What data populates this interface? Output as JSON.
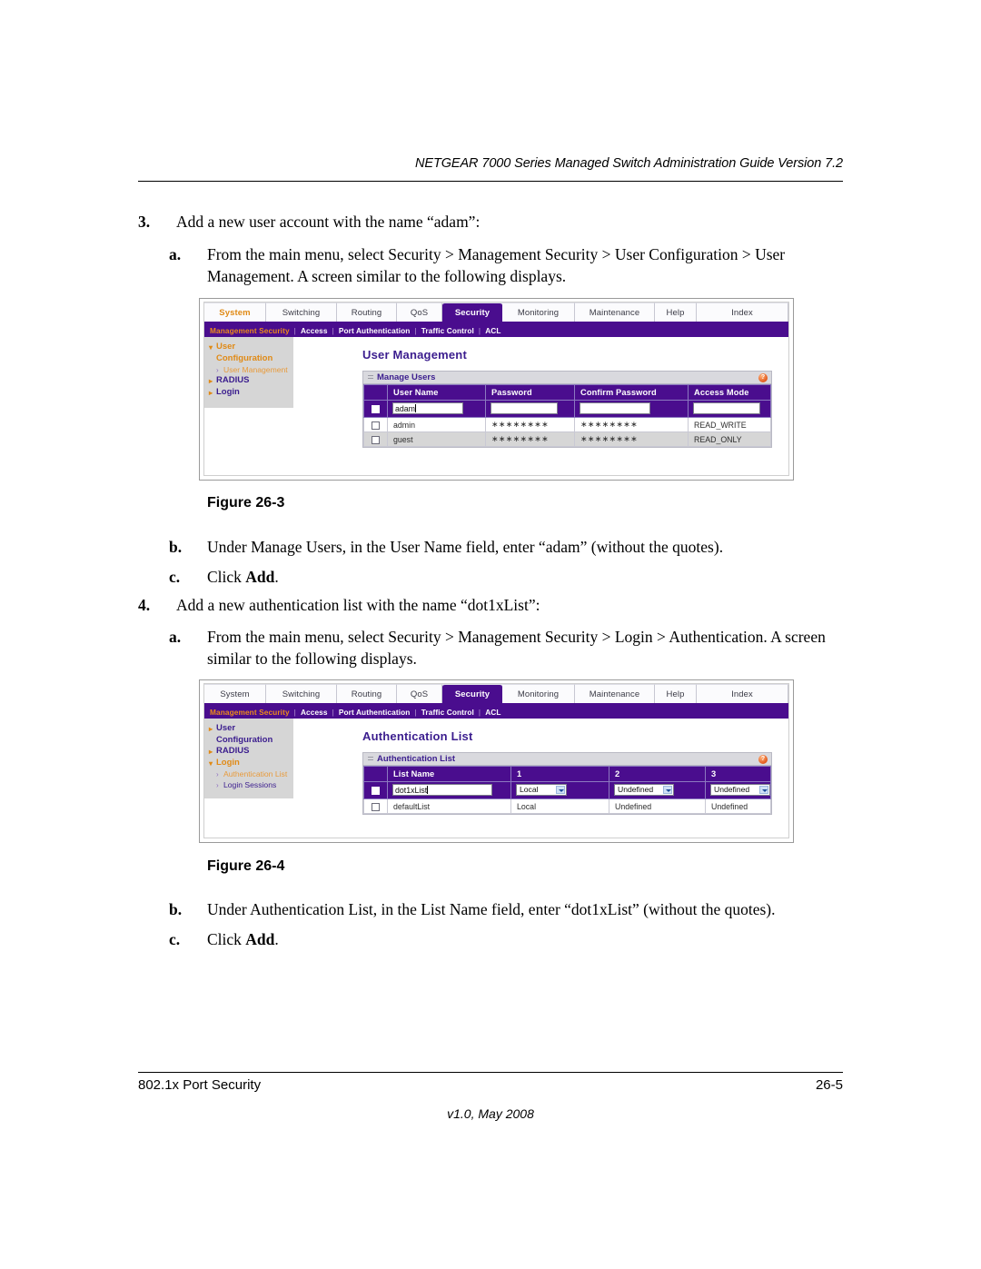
{
  "header": {
    "running_head": "NETGEAR 7000 Series Managed Switch Administration Guide Version 7.2"
  },
  "steps": [
    {
      "num": "3.",
      "text": "Add a new user account with the name “adam”:"
    },
    {
      "num": "a.",
      "text": "From the main menu, select Security > Management Security > User Configuration > User Management. A screen similar to the following displays."
    },
    {
      "num": "b.",
      "text": "Under Manage Users, in the User Name field, enter “adam” (without the quotes)."
    },
    {
      "num": "c.",
      "text_prefix": "Click ",
      "text_bold": "Add",
      "text_suffix": "."
    },
    {
      "num": "4.",
      "text": "Add a new authentication list with the name “dot1xList”:"
    },
    {
      "num": "a.",
      "text": "From the main menu, select Security > Management Security > Login > Authentication. A screen similar to the following displays."
    },
    {
      "num": "b.",
      "text": "Under Authentication List, in the List Name field, enter “dot1xList” (without the quotes)."
    },
    {
      "num": "c.",
      "text_prefix": "Click ",
      "text_bold": "Add",
      "text_suffix": "."
    }
  ],
  "captions": {
    "fig3": "Figure 26-3",
    "fig4": "Figure 26-4"
  },
  "figure1": {
    "tabs": [
      "System",
      "Switching",
      "Routing",
      "QoS",
      "Security",
      "Monitoring",
      "Maintenance",
      "Help",
      "Index"
    ],
    "active_tab": "Security",
    "subnav": [
      "Management Security",
      "Access",
      "Port Authentication",
      "Traffic Control",
      "ACL"
    ],
    "subnav_active": "Management Security",
    "sidemenu": [
      {
        "label": "User",
        "style": "orange",
        "level": "top",
        "bullet": true
      },
      {
        "label": "Configuration",
        "style": "orange",
        "level": "cont",
        "bullet": false
      },
      {
        "label": "User Management",
        "style": "orange",
        "level": "sub",
        "bullet": true
      },
      {
        "label": "RADIUS",
        "style": "purple",
        "level": "top",
        "bullet": true
      },
      {
        "label": "Login",
        "style": "purple",
        "level": "top",
        "bullet": true
      }
    ],
    "page_title": "User Management",
    "panel_title": "Manage Users",
    "help_glyph": "?",
    "columns": [
      "User Name",
      "Password",
      "Confirm Password",
      "Access Mode"
    ],
    "edit_row": {
      "user_name": "adam",
      "password": "",
      "confirm_password": "",
      "access_mode": ""
    },
    "rows": [
      {
        "user_name": "admin",
        "password": "∗∗∗∗∗∗∗∗",
        "confirm_password": "∗∗∗∗∗∗∗∗",
        "access_mode": "READ_WRITE"
      },
      {
        "user_name": "guest",
        "password": "∗∗∗∗∗∗∗∗",
        "confirm_password": "∗∗∗∗∗∗∗∗",
        "access_mode": "READ_ONLY"
      }
    ]
  },
  "figure2": {
    "tabs": [
      "System",
      "Switching",
      "Routing",
      "QoS",
      "Security",
      "Monitoring",
      "Maintenance",
      "Help",
      "Index"
    ],
    "active_tab": "Security",
    "subnav": [
      "Management Security",
      "Access",
      "Port Authentication",
      "Traffic Control",
      "ACL"
    ],
    "subnav_active": "Management Security",
    "sidemenu": [
      {
        "label": "User",
        "style": "purple",
        "level": "top",
        "bullet": true
      },
      {
        "label": "Configuration",
        "style": "purple",
        "level": "cont",
        "bullet": false
      },
      {
        "label": "RADIUS",
        "style": "purple",
        "level": "top",
        "bullet": true
      },
      {
        "label": "Login",
        "style": "orange",
        "level": "top",
        "bullet": true
      },
      {
        "label": "Authentication List",
        "style": "orange",
        "level": "sub",
        "bullet": true
      },
      {
        "label": "Login Sessions",
        "style": "purple",
        "level": "sub",
        "bullet": true
      }
    ],
    "page_title": "Authentication List",
    "panel_title": "Authentication List",
    "help_glyph": "?",
    "columns": [
      "List Name",
      "1",
      "2",
      "3"
    ],
    "edit_row": {
      "list_name": "dot1xList",
      "method1": "Local",
      "method2": "Undefined",
      "method3": "Undefined"
    },
    "rows": [
      {
        "list_name": "defaultList",
        "method1": "Local",
        "method2": "Undefined",
        "method3": "Undefined"
      }
    ]
  },
  "footer": {
    "left": "802.1x Port Security",
    "right": "26-5",
    "center": "v1.0, May 2008"
  },
  "colors": {
    "purple": "#4a0d8e",
    "menu_purple": "#3b1d8e",
    "orange": "#e08a16",
    "gray_panel": "#d9d9de",
    "sidebar_gray": "#d6d6d6"
  }
}
